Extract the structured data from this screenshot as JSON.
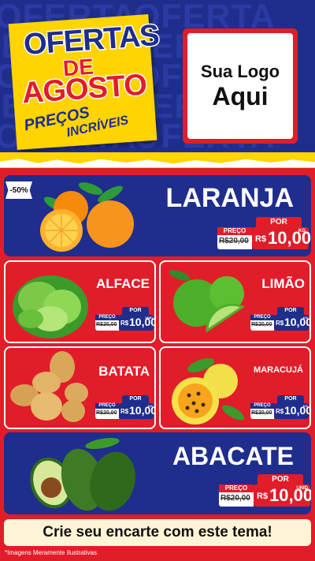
{
  "header": {
    "background_word": "OFERTA",
    "title_line1": "OFERTAS",
    "title_line2": "DE",
    "title_line3": "AGOSTO",
    "subtitle_line1": "PREÇOS",
    "subtitle_line2": "INCRÍVEIS",
    "logo_line1": "Sua Logo",
    "logo_line2": "Aqui"
  },
  "badge": "-50%",
  "products": [
    {
      "name": "LARANJA",
      "por": "POR",
      "preco_label": "PREÇO",
      "old_price": "R$20,00",
      "currency": "R$",
      "price": "10,00",
      "unit": "KG"
    },
    {
      "name": "ALFACE",
      "por": "POR",
      "preco_label": "PREÇO",
      "old_price": "R$20,00",
      "currency": "R$",
      "price": "10,00",
      "unit": "UNID"
    },
    {
      "name": "LIMÃO",
      "por": "POR",
      "preco_label": "PREÇO",
      "old_price": "R$20,00",
      "currency": "R$",
      "price": "10,00",
      "unit": "KG"
    },
    {
      "name": "BATATA",
      "por": "POR",
      "preco_label": "PREÇO",
      "old_price": "R$20,00",
      "currency": "R$",
      "price": "10,00",
      "unit": "KG"
    },
    {
      "name": "MARACUJÁ",
      "por": "POR",
      "preco_label": "PREÇO",
      "old_price": "R$20,00",
      "currency": "R$",
      "price": "10,00",
      "unit": "KG"
    },
    {
      "name": "ABACATE",
      "por": "POR",
      "preco_label": "PREÇO",
      "old_price": "R$20,00",
      "currency": "R$",
      "price": "10,00",
      "unit": "UNID"
    }
  ],
  "cta": "Crie seu encarte com este tema!",
  "footnote": "*Imagens Meramente Ilustrativas",
  "colors": {
    "blue": "#1f2d8c",
    "red": "#e11d2a",
    "yellow": "#ffd400",
    "white": "#ffffff"
  }
}
